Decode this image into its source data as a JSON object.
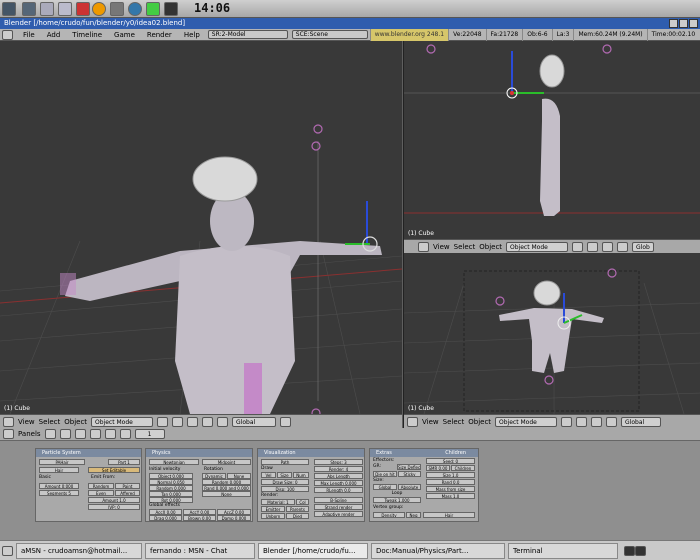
{
  "clock": "14:06",
  "window_title": "Blender [/home/crudo/fun/blender/y0/idea02.blend]",
  "menu": [
    "File",
    "Add",
    "Timeline",
    "Game",
    "Render",
    "Help"
  ],
  "screen_field": "SR:2-Model",
  "scene_field": "SCE:Scene",
  "url": "www.blender.org 248.1",
  "stats": [
    "Ve:22048",
    "Fa:21728",
    "Ob:6-6",
    "La:3",
    "Mem:60.24M (9.24M)",
    "Time:00:02.10"
  ],
  "viewports": {
    "main": {
      "label": "(1) Cube",
      "menus": [
        "View",
        "Select",
        "Object"
      ],
      "mode": "Object Mode",
      "orientation": "Global"
    },
    "top_right": {
      "label": "(1) Cube",
      "menus": [
        "View",
        "Select",
        "Object"
      ],
      "mode": "Object Mode",
      "orientation": "Glob"
    },
    "bottom_right": {
      "label": "(1) Cube",
      "menus": [
        "View",
        "Select",
        "Object"
      ],
      "mode": "Object Mode",
      "orientation": "Global"
    }
  },
  "buttons_header": {
    "panels_label": "Panels",
    "frame": "1"
  },
  "panels": {
    "particle_system": {
      "title": "Particle System",
      "system": "PAHair",
      "hair": "Hair",
      "set_editable": "Set Editable",
      "part": "Part 1",
      "basic": "Basic",
      "amount": "Amount 0:000",
      "segments": "Segments 5",
      "emit_from": "Emit From:",
      "random": "Random",
      "even": "Even",
      "paint": "Paint",
      "affered": "Affered",
      "amount2": "Amount 1.0",
      "jvp": "JVP: 0"
    },
    "physics": {
      "title": "Physics",
      "newtonian": "Newtonian",
      "initial_velocity": "Initial velocity",
      "object": "Object 0.000",
      "normal": "Normal 0.050",
      "random": "Random 0.000",
      "tan": "Tan 0.000",
      "rot": "Rot 0.000",
      "global_effects": "Global effects",
      "accx": "AccX 0.00",
      "accy": "AccY 0.00",
      "accz": "AccZ 0.00",
      "drag": "Drag 0.000",
      "brown": "Brown 0.00",
      "damp": "Damp 0.000",
      "rotation": "Rotation",
      "dynamic": "Dynamic",
      "none": "None",
      "rand": "Random 0.000",
      "rand_phase": "Rand 0.000 and 0.000",
      "midpoint": "Midpoint",
      "none2": "None"
    },
    "visualization": {
      "title": "Visualization",
      "path": "Path",
      "draw": "Draw",
      "vel": "Vel",
      "size": "Size",
      "num": "Num",
      "draw_size": "Draw Size: 0",
      "disp": "Disp: 100",
      "render": "Render:",
      "material": "Material: 1",
      "col": "Col",
      "emitter": "Emitter",
      "parents": "Parents",
      "unborn": "Unborn",
      "died": "Died",
      "steps": "Steps: 3",
      "render2": "Render: 4",
      "abs_length": "Abs Length",
      "max_length": "Max Length 0.000",
      "rlength": "RLength 0.0",
      "b_spline": "B-Spline",
      "strand_render": "Strand render",
      "adaptive_render": "Adaptive render"
    },
    "extras": {
      "title": "Extras",
      "children": "Children",
      "effectors": "Effectors:",
      "gr": "GR:",
      "size_deflect": "Size Deflect",
      "die_on_hit": "Die on hit",
      "sticky": "Sticky",
      "seed": "Seed: 0",
      "size": "Size:",
      "global": "Global",
      "absolute": "Absolute",
      "size_val": "Size 1.0",
      "rand_val": "Rand 0.0",
      "loop": "Loop",
      "tweak": "Tweak 1.000",
      "vertex_group": "Vertex group:",
      "density": "Density",
      "neg": "Neg",
      "hair": "Hair",
      "time": "Time:",
      "mass_from_size": "Mass from size",
      "mass": "Mass 1.0",
      "time_val": "SMR 0.00",
      "child": "Children"
    }
  },
  "taskbar": [
    "aMSN - crudoamsn@hotmail...",
    "fernando : MSN - Chat",
    "Blender [/home/crudo/fu...",
    "Doc:Manual/Physics/Part...",
    "Terminal"
  ]
}
